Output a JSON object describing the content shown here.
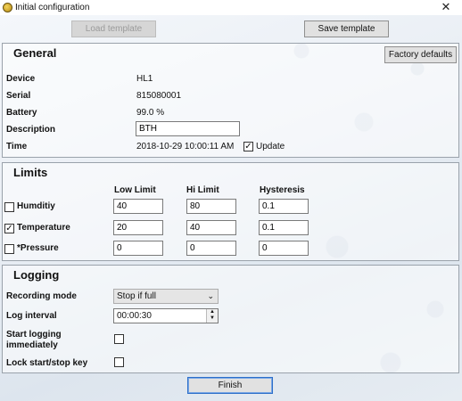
{
  "window": {
    "title": "Initial configuration",
    "close_glyph": "✕",
    "icon": "app-icon"
  },
  "toolbar": {
    "load_template": "Load template",
    "save_template": "Save template"
  },
  "general": {
    "title": "General",
    "factory_defaults": "Factory defaults",
    "device_label": "Device",
    "device_value": "HL1",
    "serial_label": "Serial",
    "serial_value": "815080001",
    "battery_label": "Battery",
    "battery_value": "99.0 %",
    "description_label": "Description",
    "description_value": "BTH",
    "time_label": "Time",
    "time_value": "2018-10-29 10:00:11 AM",
    "update_label": "Update",
    "update_checked": true
  },
  "limits": {
    "title": "Limits",
    "columns": [
      "Low Limit",
      "Hi Limit",
      "Hysteresis"
    ],
    "rows": [
      {
        "label": "Humditiy",
        "checked": false,
        "low": "40",
        "hi": "80",
        "hyst": "0.1"
      },
      {
        "label": "Temperature",
        "checked": true,
        "low": "20",
        "hi": "40",
        "hyst": "0.1"
      },
      {
        "label": "*Pressure",
        "checked": false,
        "low": "0",
        "hi": "0",
        "hyst": "0"
      }
    ]
  },
  "logging": {
    "title": "Logging",
    "recording_mode_label": "Recording mode",
    "recording_mode_value": "Stop if full",
    "log_interval_label": "Log interval",
    "log_interval_value": "00:00:30",
    "start_immediately_label_1": "Start logging",
    "start_immediately_label_2": "immediately",
    "start_immediately_checked": false,
    "lock_key_label": "Lock start/stop key",
    "lock_key_checked": false
  },
  "footer": {
    "finish": "Finish"
  },
  "colors": {
    "accent_border": "#2d6fc9",
    "group_border": "#9aa2ab"
  }
}
